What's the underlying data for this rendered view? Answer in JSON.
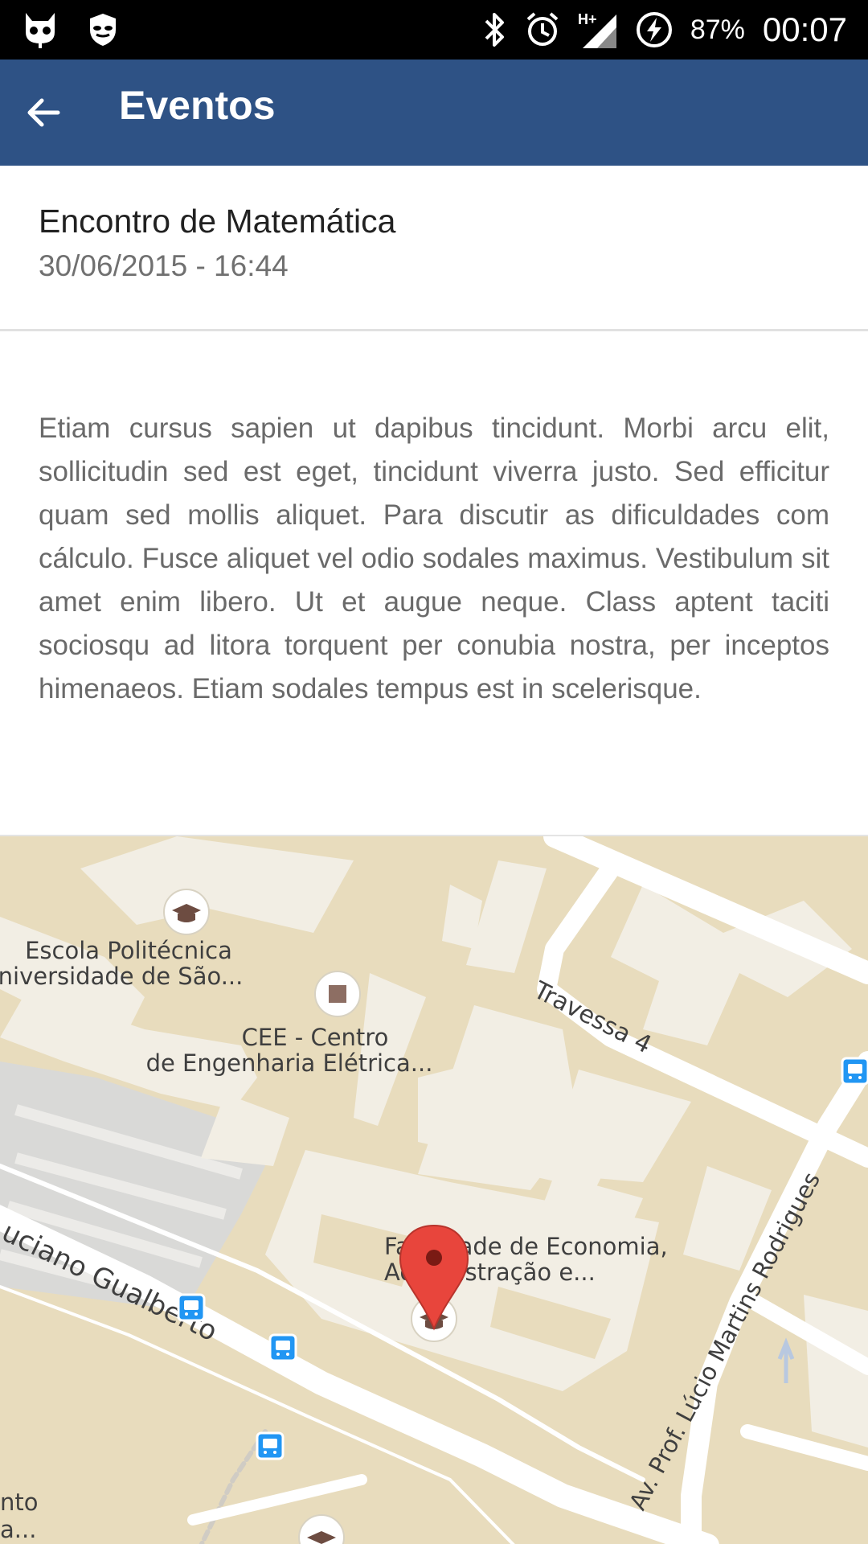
{
  "status_bar": {
    "icons_left": [
      "cyanogen-mascot-icon",
      "privacy-guard-icon"
    ],
    "icons_right": [
      "bluetooth-icon",
      "alarm-icon",
      "signal-hplus-icon",
      "battery-charging-icon"
    ],
    "network_type": "H+",
    "battery": "87%",
    "time": "00:07"
  },
  "toolbar": {
    "title": "Eventos",
    "back_icon": "arrow-back-icon",
    "color": "#2e5285"
  },
  "event": {
    "title": "Encontro de Matemática",
    "datetime": "30/06/2015 - 16:44",
    "description": "Etiam cursus sapien ut dapibus tincidunt. Morbi arcu elit, sollicitudin sed est eget, tincidunt viverra justo. Sed efficitur quam sed mollis aliquet. Para discutir as dificuldades com cálculo. Fusce aliquet vel odio sodales maximus. Vestibulum sit amet enim libero. Ut et augue neque. Class aptent taciti sociosqu ad litora torquent per conubia nostra, per inceptos himenaeos. Etiam sodales tempus est in scelerisque."
  },
  "map": {
    "labels": {
      "escola_line1": "Escola Politécnica",
      "escola_line2": "niversidade de São...",
      "cee_line1": "CEE - Centro",
      "cee_line2": "de Engenharia Elétrica...",
      "street_travessa": "Travessa 4",
      "street_lucio": "Av. Prof. Lúcio Martins Rodrigues",
      "street_luciano": "uciano Gualberto",
      "fea_line1": "Faculdade de Economia,",
      "fea_line2": "Administração e...",
      "bottom_left_line1": "nto",
      "bottom_left_line2": "a..."
    },
    "colors": {
      "land": "#e8dcbd",
      "building": "#f2eee4",
      "road": "#ffffff",
      "parking": "#d9d9d7",
      "marker": "#e8453c",
      "transit": "#2196f3"
    }
  }
}
